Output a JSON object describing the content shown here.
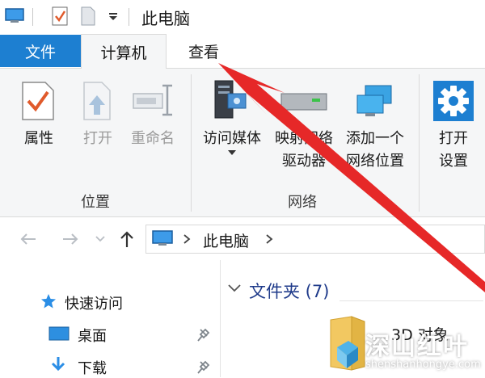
{
  "window": {
    "title": "此电脑"
  },
  "tabs": {
    "file": "文件",
    "computer": "计算机",
    "view": "查看"
  },
  "ribbon": {
    "buttons": {
      "properties": "属性",
      "open": "打开",
      "rename": "重命名",
      "media_line1": "访问媒体",
      "map_line1": "映射网络",
      "map_line2": "驱动器",
      "addnet_line1": "添加一个",
      "addnet_line2": "网络位置",
      "settings_line1": "打开",
      "settings_line2": "设置"
    },
    "groups": {
      "location": "位置",
      "network": "网络"
    }
  },
  "address": {
    "path": "此电脑"
  },
  "nav_pane": {
    "quick_access": "快速访问",
    "desktop": "桌面",
    "downloads": "下载"
  },
  "content": {
    "section_header": "文件夹 (7)",
    "item_3d": "3D 对象"
  },
  "watermark": {
    "cn": "深山红叶",
    "url": "shenshanhongye.com"
  },
  "colors": {
    "accent": "#1d7fd1",
    "arrow": "#e62828",
    "ribbon_bg": "#f5f6f7"
  }
}
